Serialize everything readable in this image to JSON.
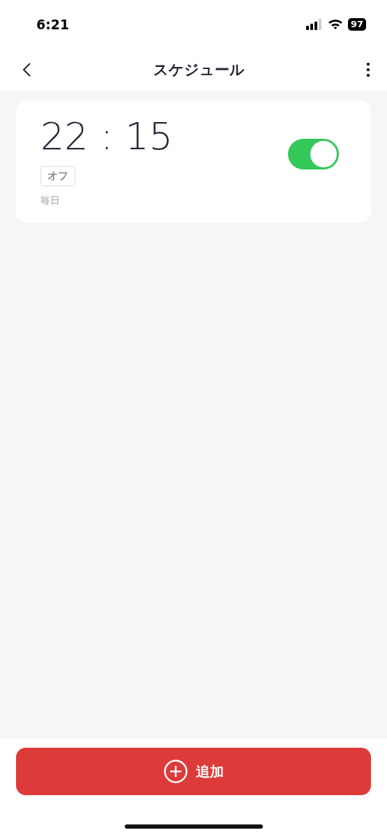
{
  "status_bar": {
    "time": "6:21",
    "battery": "97"
  },
  "nav": {
    "title": "スケジュール"
  },
  "schedules": [
    {
      "time": "22 : 15",
      "action": "オフ",
      "repeat": "毎日",
      "on": true
    }
  ],
  "add_button": {
    "label": "追加"
  }
}
